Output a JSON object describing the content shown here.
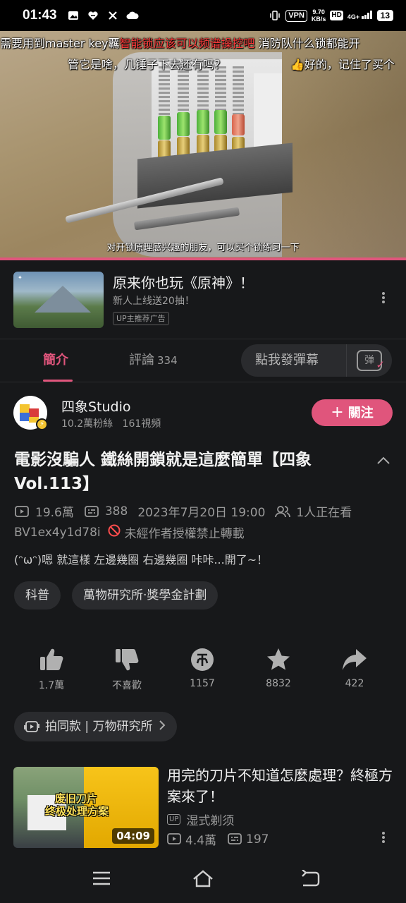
{
  "status_bar": {
    "time": "01:43",
    "vpn": "VPN",
    "net_speed_value": "9.70",
    "net_speed_unit": "KB/s",
    "hd": "HD",
    "signal": "4G+",
    "battery": "13"
  },
  "video": {
    "danmaku": [
      {
        "prefix": "需要用到master key覊",
        "red": "智能锁应该可以频谱操控吧",
        "suffix": " 消防队什么锁都能开"
      },
      {
        "text": "管它是啥，几锤子下去还有吗？"
      },
      {
        "text": "好的，记住了买个"
      }
    ],
    "subtitle": "对开锁原理感兴趣的朋友，可以买个锁练习一下",
    "progress_fraction": 1.0
  },
  "ad": {
    "title": "原来你也玩《原神》！",
    "subtitle": "新人上线送20抽！",
    "badge": "UP主推荐广告"
  },
  "tabs": {
    "intro": "簡介",
    "comments": "評論",
    "comments_count": "334",
    "danmaku_input": "點我發彈幕",
    "danmaku_toggle": "弹"
  },
  "uploader": {
    "name": "四象Studio",
    "fans": "10.2萬粉絲",
    "videos": "161視頻",
    "follow_label": "關注"
  },
  "info": {
    "title": "電影沒騙人 鐵絲開鎖就是這麼簡單【四象Vol.113】",
    "views": "19.6萬",
    "danmaku_count": "388",
    "date": "2023年7月20日 19:00",
    "watching": "1人正在看",
    "bvid": "BV1ex4y1d78i",
    "no_repost": "未經作者授權禁止轉載",
    "description": "(ᵔωᵔ)嗯 就這樣 左邊幾圈 右邊幾圈 咔咔...開了~！",
    "tags": [
      "科普",
      "萬物研究所·獎學金計劃"
    ]
  },
  "actions": {
    "like": "1.7萬",
    "dislike": "不喜歡",
    "coin": "1157",
    "favorite": "8832",
    "share": "422"
  },
  "same_style": "拍同款 | 万物研究所",
  "recommended": {
    "title": "用完的刀片不知道怎麼處理？終極方案來了！",
    "thumb_caption_line1": "废旧刀片",
    "thumb_caption_line2": "终极处理方案",
    "duration": "04:09",
    "up_badge": "UP",
    "uploader": "湿式剃须",
    "views": "4.4萬",
    "danmaku": "197"
  },
  "colors": {
    "accent": "#e0557c",
    "background": "#17181a",
    "chip": "#2a2b2e",
    "warning": "#ff4d4d"
  }
}
